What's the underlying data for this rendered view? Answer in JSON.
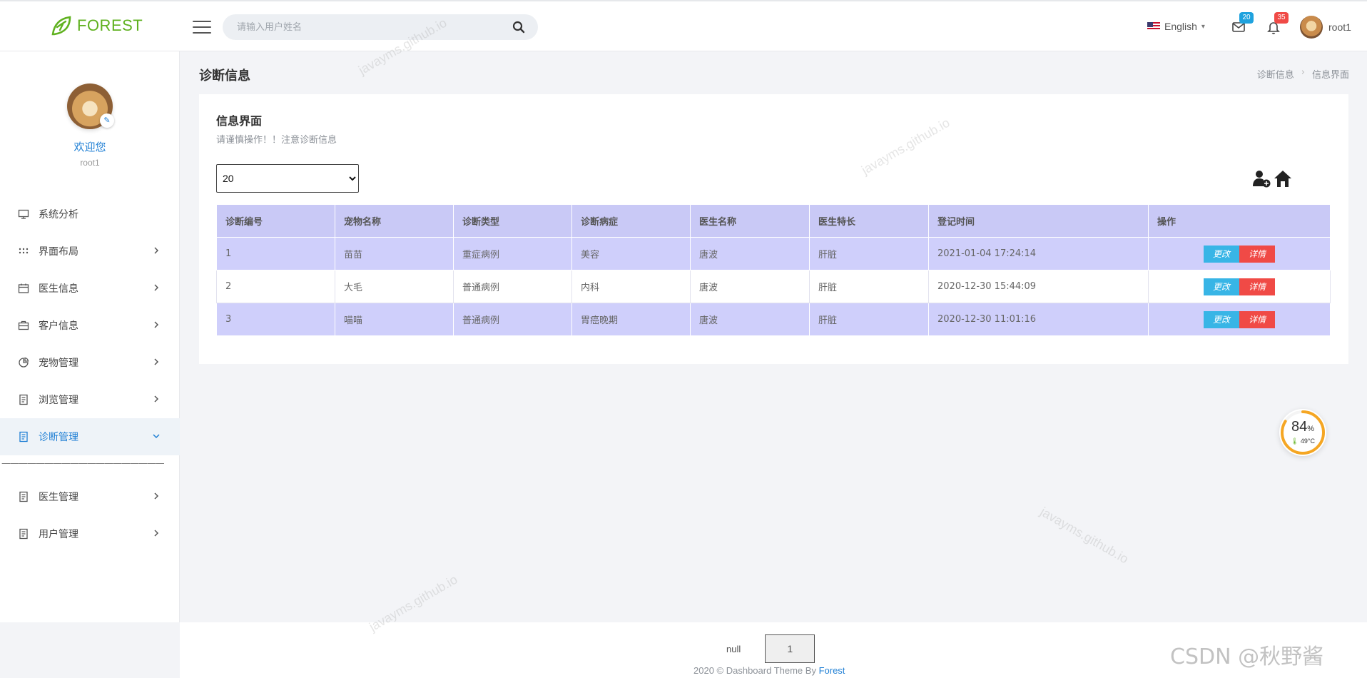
{
  "brand": {
    "name": "FOREST"
  },
  "header": {
    "search_placeholder": "请输入用户姓名",
    "language": "English",
    "mail_count": "20",
    "notify_count": "35",
    "user_name": "root1",
    "colors": {
      "brand": "#5fb11f",
      "mail_badge": "#1fa2de",
      "notify_badge": "#f04a46"
    }
  },
  "sidebar": {
    "welcome": "欢迎您",
    "user": "root1",
    "divider": "———————————————————————",
    "items": [
      {
        "label": "系统分析",
        "icon": "monitor-icon"
      },
      {
        "label": "界面布局",
        "icon": "grid-dots-icon"
      },
      {
        "label": "医生信息",
        "icon": "calendar-icon"
      },
      {
        "label": "客户信息",
        "icon": "briefcase-icon"
      },
      {
        "label": "宠物管理",
        "icon": "pie-chart-icon"
      },
      {
        "label": "浏览管理",
        "icon": "document-icon"
      },
      {
        "label": "诊断管理",
        "icon": "document-icon"
      },
      {
        "label": "医生管理",
        "icon": "document-icon"
      },
      {
        "label": "用户管理",
        "icon": "document-icon"
      }
    ]
  },
  "page": {
    "title": "诊断信息",
    "breadcrumb": [
      "诊断信息",
      "信息界面"
    ]
  },
  "card": {
    "title": "信息界面",
    "subtitle": "请谨慎操作！！注意诊断信息",
    "page_size": "20",
    "page_size_options": [
      "20"
    ]
  },
  "table": {
    "headers": [
      "诊断编号",
      "宠物名称",
      "诊断类型",
      "诊断病症",
      "医生名称",
      "医生特长",
      "登记时间",
      "操作"
    ],
    "rows": [
      [
        "1",
        "苗苗",
        "重症病例",
        "美容",
        "唐波",
        "肝脏",
        "2021-01-04 17:24:14"
      ],
      [
        "2",
        "大毛",
        "普通病例",
        "内科",
        "唐波",
        "肝脏",
        "2020-12-30 15:44:09"
      ],
      [
        "3",
        "喵喵",
        "普通病例",
        "胃癌晚期",
        "唐波",
        "肝脏",
        "2020-12-30 11:01:16"
      ]
    ],
    "edit_label": "更改",
    "detail_label": "详情"
  },
  "monitor": {
    "percent": "84",
    "unit": "%",
    "temp": "49°C",
    "ring_fraction": 0.84
  },
  "pager": {
    "prev": "null",
    "current": "1"
  },
  "footer": {
    "text": "2020 © Dashboard Theme By ",
    "link": "Forest"
  },
  "watermarks": {
    "site": "javayms.github.io",
    "csdn": "CSDN @秋野酱"
  }
}
